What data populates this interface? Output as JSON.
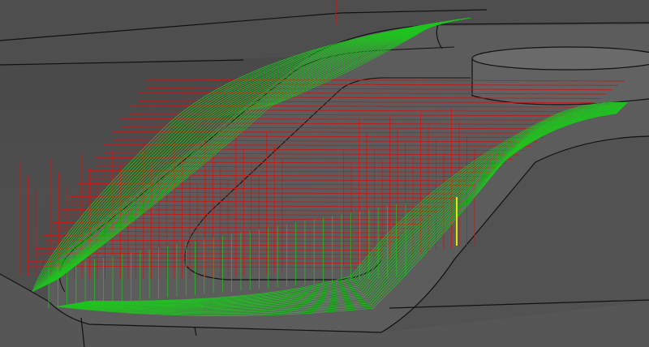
{
  "viewport": {
    "background_color": "#4a4a4a",
    "model_surface_color": "#5a5a5a",
    "model_edge_color": "#111111",
    "toolpath_feed_color": "#1fc41f",
    "toolpath_rapid_color": "#c81818",
    "highlight_segment_color": "#e6e600",
    "axis_marker_color": "#c81818"
  }
}
